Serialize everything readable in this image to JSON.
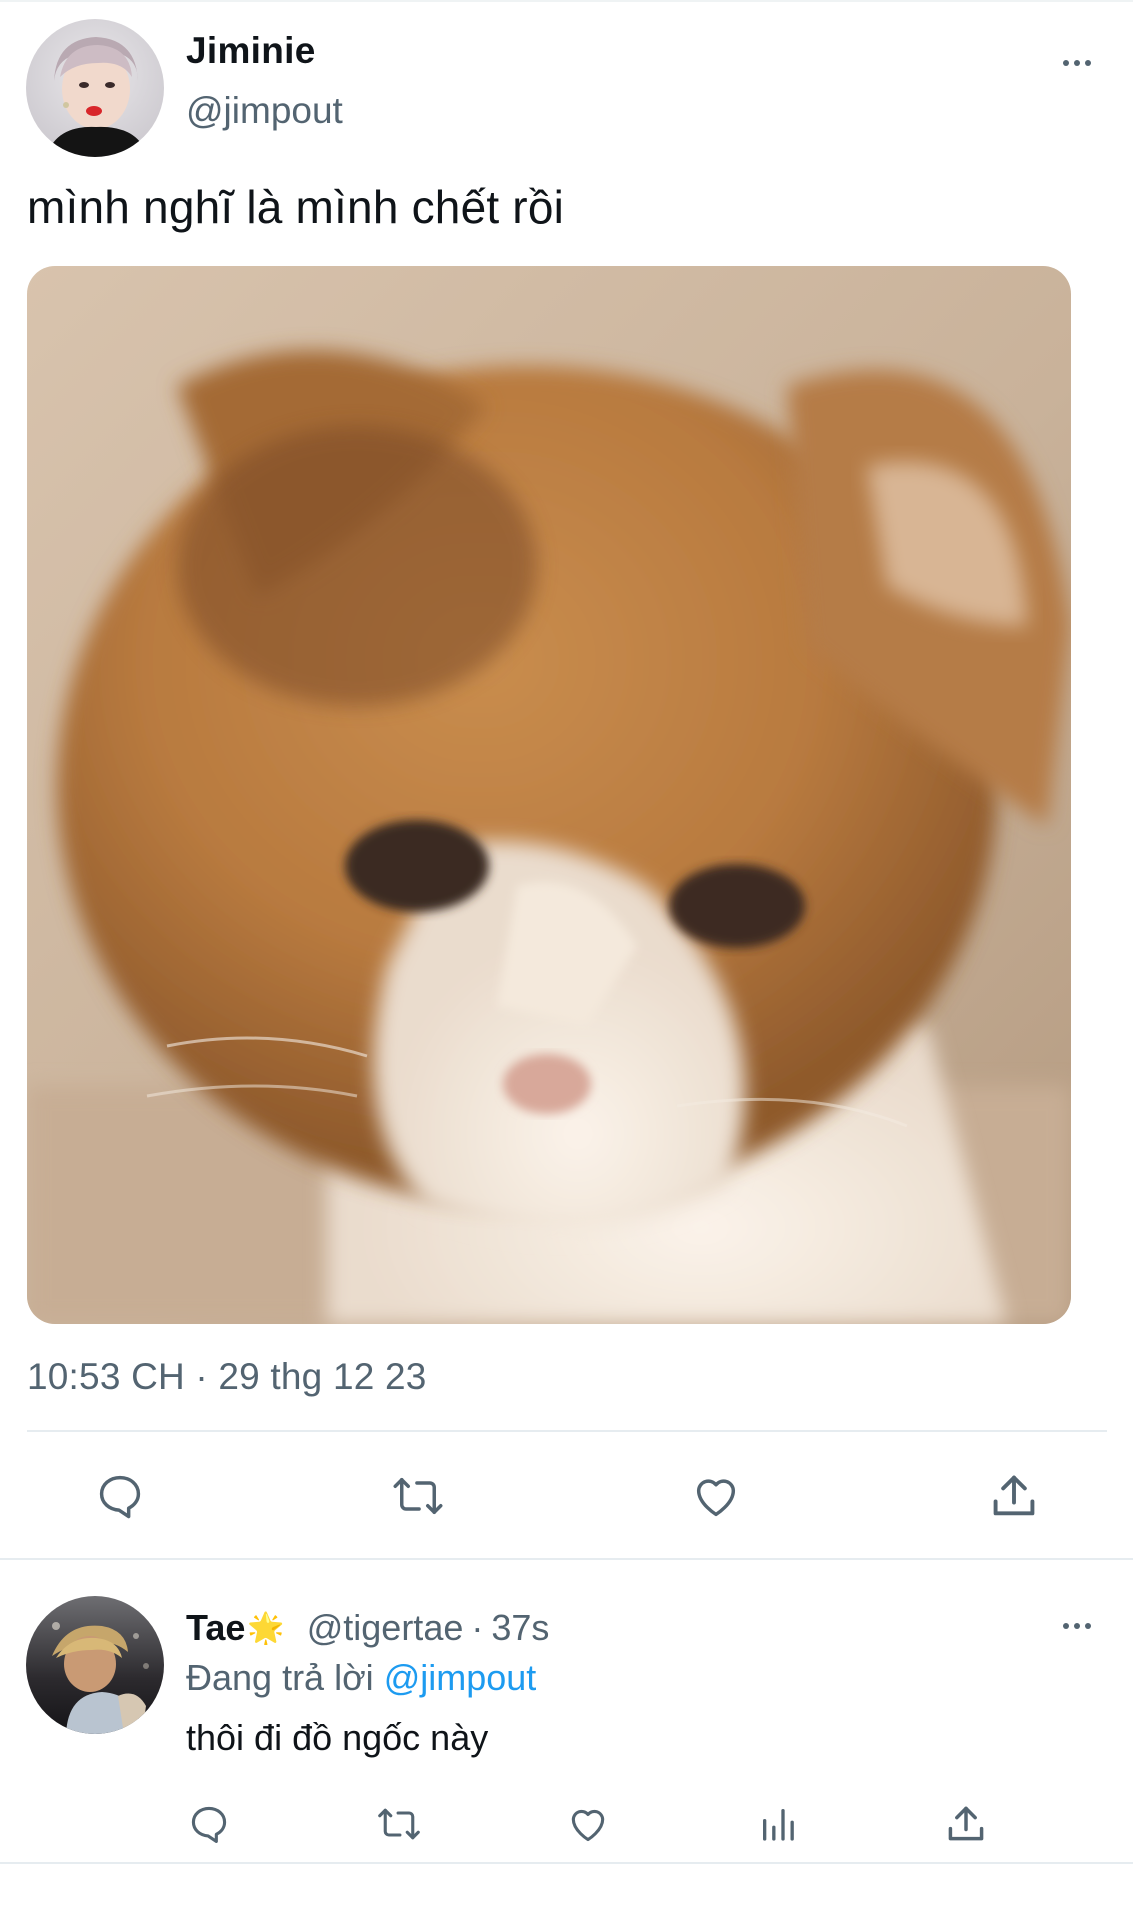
{
  "tweet": {
    "author_name": "Jiminie",
    "author_handle": "@jimpout",
    "text": "mình nghĩ là mình chết rồi",
    "media_alt": "orange and white kitten looking down",
    "timestamp": "10:53 CH · 29 thg 12 23",
    "actions": [
      "reply-icon",
      "retweet-icon",
      "like-icon",
      "share-icon"
    ]
  },
  "reply": {
    "author_name": "Tae",
    "name_emoji": "🌟",
    "author_handle": "@tigertae",
    "separator": "·",
    "time_ago": "37s",
    "replying_prefix": "Đang trả lời",
    "replying_to": "@jimpout",
    "text": "thôi đi đồ ngốc này",
    "actions": [
      "reply-icon",
      "retweet-icon",
      "like-icon",
      "analytics-icon",
      "share-icon"
    ]
  },
  "colors": {
    "text_primary": "#0f1419",
    "text_secondary": "#536471",
    "link": "#1d9bf0",
    "divider": "#e6ecf0",
    "icon": "#536471"
  }
}
